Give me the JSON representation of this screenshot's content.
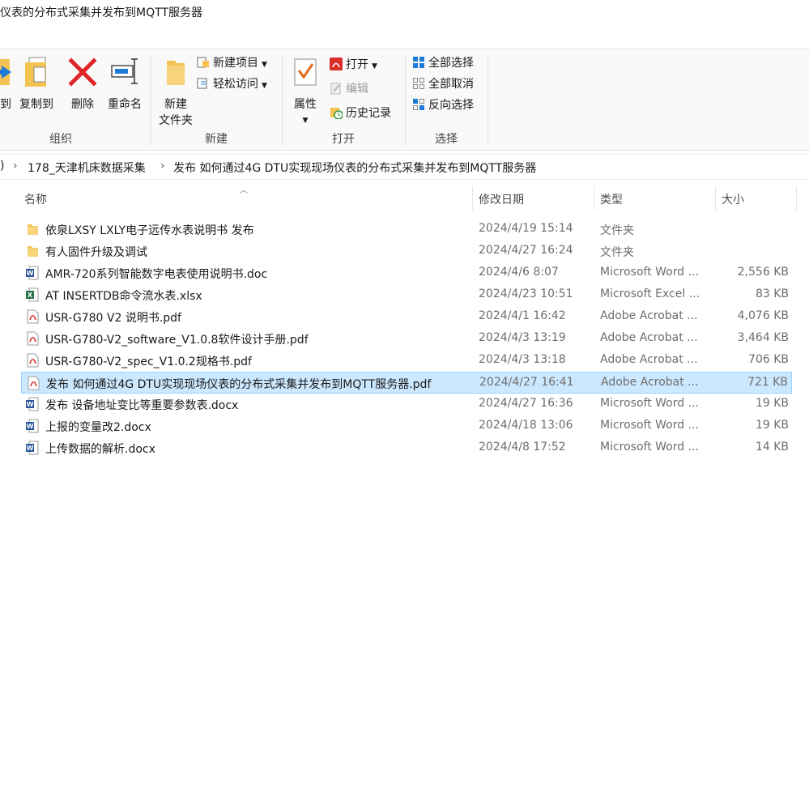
{
  "window": {
    "title": "仪表的分布式采集并发布到MQTT服务器"
  },
  "ribbon": {
    "organize": {
      "label": "组织",
      "move_to": "动到",
      "copy_to": "复制到",
      "delete": "删除",
      "rename": "重命名"
    },
    "new": {
      "label": "新建",
      "new_folder_line1": "新建",
      "new_folder_line2": "文件夹",
      "new_item": "新建项目",
      "easy_access": "轻松访问"
    },
    "open": {
      "label": "打开",
      "properties": "属性",
      "open": "打开",
      "edit": "编辑",
      "history": "历史记录"
    },
    "select": {
      "label": "选择",
      "select_all": "全部选择",
      "select_none": "全部取消",
      "invert": "反向选择"
    }
  },
  "address": {
    "lead": ")",
    "crumbs": [
      "178_天津机床数据采集",
      "发布 如何通过4G DTU实现现场仪表的分布式采集并发布到MQTT服务器"
    ]
  },
  "columns": {
    "name": "名称",
    "date": "修改日期",
    "type": "类型",
    "size": "大小"
  },
  "files": [
    {
      "name": "依泉LXSY LXLY电子远传水表说明书 发布",
      "date": "2024/4/19 15:14",
      "type": "文件夹",
      "size": "",
      "icon": "folder-icon"
    },
    {
      "name": "有人固件升级及调试",
      "date": "2024/4/27 16:24",
      "type": "文件夹",
      "size": "",
      "icon": "folder-icon"
    },
    {
      "name": "AMR-720系列智能数字电表使用说明书.doc",
      "date": "2024/4/6 8:07",
      "type": "Microsoft Word ...",
      "size": "2,556 KB",
      "icon": "word-icon"
    },
    {
      "name": "AT INSERTDB命令流水表.xlsx",
      "date": "2024/4/23 10:51",
      "type": "Microsoft Excel ...",
      "size": "83 KB",
      "icon": "excel-icon"
    },
    {
      "name": "USR-G780 V2 说明书.pdf",
      "date": "2024/4/1 16:42",
      "type": "Adobe Acrobat ...",
      "size": "4,076 KB",
      "icon": "pdf-icon"
    },
    {
      "name": "USR-G780-V2_software_V1.0.8软件设计手册.pdf",
      "date": "2024/4/3 13:19",
      "type": "Adobe Acrobat ...",
      "size": "3,464 KB",
      "icon": "pdf-icon"
    },
    {
      "name": "USR-G780-V2_spec_V1.0.2规格书.pdf",
      "date": "2024/4/3 13:18",
      "type": "Adobe Acrobat ...",
      "size": "706 KB",
      "icon": "pdf-icon"
    },
    {
      "name": "发布 如何通过4G DTU实现现场仪表的分布式采集并发布到MQTT服务器.pdf",
      "date": "2024/4/27 16:41",
      "type": "Adobe Acrobat ...",
      "size": "721 KB",
      "icon": "pdf-icon",
      "selected": true
    },
    {
      "name": "发布 设备地址变比等重要参数表.docx",
      "date": "2024/4/27 16:36",
      "type": "Microsoft Word ...",
      "size": "19 KB",
      "icon": "word-icon"
    },
    {
      "name": "上报的变量改2.docx",
      "date": "2024/4/18 13:06",
      "type": "Microsoft Word ...",
      "size": "19 KB",
      "icon": "word-icon"
    },
    {
      "name": "上传数据的解析.docx",
      "date": "2024/4/8 17:52",
      "type": "Microsoft Word ...",
      "size": "14 KB",
      "icon": "word-icon"
    }
  ],
  "colors": {
    "selection_bg": "#cce8ff",
    "selection_border": "#99d1ff",
    "folder": "#f4c351",
    "word": "#2b579a",
    "excel": "#217346",
    "pdf": "#d9302c"
  }
}
